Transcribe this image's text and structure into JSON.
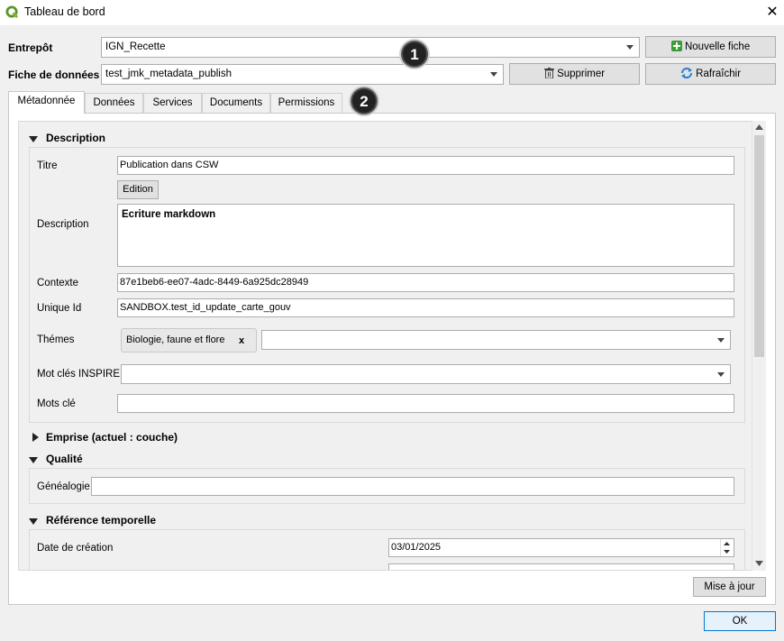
{
  "window": {
    "title": "Tableau de bord",
    "close_label": "✕"
  },
  "toolbar": {
    "entrepot_label": "Entrepôt",
    "entrepot_value": "IGN_Recette",
    "fiche_label": "Fiche de données",
    "fiche_value": "test_jmk_metadata_publish",
    "new_label": "Nouvelle fiche",
    "delete_label": "Supprimer",
    "refresh_label": "Rafraîchir"
  },
  "badges": [
    "1",
    "2"
  ],
  "tabs": [
    {
      "label": "Métadonnée",
      "active": true
    },
    {
      "label": "Données"
    },
    {
      "label": "Services"
    },
    {
      "label": "Documents"
    },
    {
      "label": "Permissions"
    }
  ],
  "description": {
    "header": "Description",
    "titre_label": "Titre",
    "titre_value": "Publication dans CSW",
    "edition_label": "Edition",
    "description_label": "Description",
    "description_value": "Ecriture markdown",
    "contexte_label": "Contexte",
    "contexte_value": "87e1beb6-ee07-4adc-8449-6a925dc28949",
    "unique_label": "Unique Id",
    "unique_value": "SANDBOX.test_id_update_carte_gouv",
    "themes_label": "Thémes",
    "theme_chip": "Biologie, faune et flore",
    "chip_remove": "x",
    "inspire_label": "Mot clés INSPIRE",
    "mots_label": "Mots clé"
  },
  "emprise": {
    "header": "Emprise (actuel : couche)"
  },
  "qualite": {
    "header": "Qualité",
    "genealogie_label": "Généalogie"
  },
  "temporelle": {
    "header": "Référence temporelle",
    "creation_label": "Date de création",
    "creation_value": "03/01/2025"
  },
  "footer": {
    "update_label": "Mise à jour",
    "ok_label": "OK"
  }
}
